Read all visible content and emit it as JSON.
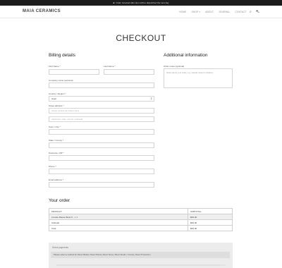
{
  "topbar": {
    "icon": "truck-icon",
    "text": "Order received after 4pm will be dispatched the next day"
  },
  "header": {
    "logo": "MAIA CERAMICS",
    "nav": [
      "HOME",
      "SHOP ▾",
      "ABOUT",
      "JOURNAL",
      "CONTACT"
    ],
    "search_icon": "search-icon",
    "cart_icon": "cart-icon"
  },
  "page_title": "CHECKOUT",
  "billing": {
    "title": "Billing details",
    "first_name_label": "First Name *",
    "last_name_label": "Last Name *",
    "company_label": "Company name (optional)",
    "country_label": "Country / Region *",
    "country_value": "Israel",
    "street_label": "Street address *",
    "street_placeholder": "House number and street name",
    "street2_placeholder": "Apartment, suite, unit etc. (optional)",
    "town_label": "Town / City *",
    "state_label": "State / County *",
    "postcode_label": "Postcode / ZIP *",
    "phone_label": "Phone *",
    "email_label": "Email address *"
  },
  "additional": {
    "title": "Additional information",
    "notes_label": "Order notes (optional)",
    "notes_placeholder": "Notes about your order, e.g. special notes for delivery."
  },
  "order": {
    "title": "Your order",
    "col_product": "PRODUCT",
    "col_subtotal": "SUBTOTAL",
    "rows": [
      {
        "product": "Lunette Mauve Bowl S - × 1",
        "subtotal": "$69.00"
      },
      {
        "product": "Subtotal",
        "subtotal": "$69.00"
      },
      {
        "product": "Total",
        "subtotal": "$69.00"
      }
    ]
  },
  "payment": {
    "title": "Direct payments",
    "message": "Please select a method for Direct Market, Direct Parcel, Direct Serve, Direct Studio / Country, Direct Production"
  }
}
